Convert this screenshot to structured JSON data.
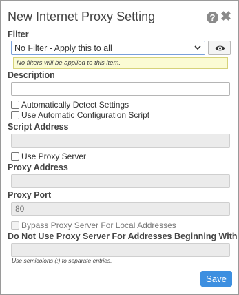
{
  "dialog": {
    "title": "New Internet Proxy Setting",
    "help_glyph": "?",
    "close_glyph": "✖",
    "help_icon": "question-circle-icon",
    "close_icon": "close-icon"
  },
  "filter": {
    "label": "Filter",
    "selected": "No Filter - Apply this to all",
    "tooltip": "No filters will be applied to this item.",
    "preview_icon": "eye-icon"
  },
  "description": {
    "label": "Description",
    "value": ""
  },
  "options": {
    "auto_detect": {
      "label": "Automatically Detect Settings",
      "checked": false
    },
    "auto_config_script": {
      "label": "Use Automatic Configuration Script",
      "checked": false
    }
  },
  "script_address": {
    "label": "Script Address",
    "value": ""
  },
  "use_proxy_server": {
    "label": "Use Proxy Server",
    "checked": false
  },
  "proxy_address": {
    "label": "Proxy Address",
    "value": ""
  },
  "proxy_port": {
    "label": "Proxy Port",
    "value": "80"
  },
  "bypass_local": {
    "label": "Bypass Proxy Server For Local Addresses",
    "checked": false
  },
  "exceptions": {
    "label": "Do Not Use Proxy Server For Addresses Beginning With",
    "value": "",
    "hint": "Use semicolons (;) to separate entries."
  },
  "actions": {
    "save_label": "Save"
  },
  "colors": {
    "accent": "#3d8fe0",
    "tooltip_bg": "#fbfbd4",
    "disabled_field": "#ebebeb"
  }
}
